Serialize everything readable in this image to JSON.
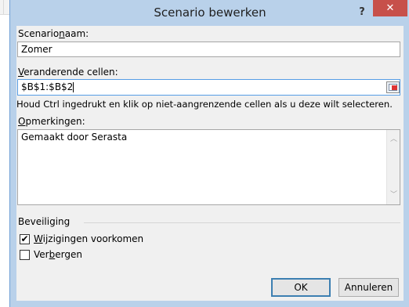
{
  "window": {
    "title": "Scenario bewerken",
    "help_label": "?",
    "close_label": "✕"
  },
  "form": {
    "name_label_pre": "Scenario",
    "name_label_u": "n",
    "name_label_post": "aam:",
    "name_value": "Zomer",
    "cells_label_u": "V",
    "cells_label_post": "eranderende cellen:",
    "cells_value": "$B$1:$B$2",
    "hint": "Houd Ctrl ingedrukt en klik op niet-aangrenzende cellen als u deze wilt selecteren.",
    "comments_label_u": "O",
    "comments_label_post": "pmerkingen:",
    "comments_value": "Gemaakt door Serasta"
  },
  "protection": {
    "group_label": "Beveiliging",
    "prevent_changes_u": "W",
    "prevent_changes_post": "ijzigingen voorkomen",
    "prevent_changes_checked": true,
    "hide_pre": "Ver",
    "hide_u": "b",
    "hide_post": "ergen",
    "hide_checked": false
  },
  "buttons": {
    "ok": "OK",
    "cancel": "Annuleren"
  },
  "colors": {
    "title_bar": "#b9d1ea",
    "close_button": "#c7504a",
    "dialog_body": "#f0f0f0"
  }
}
